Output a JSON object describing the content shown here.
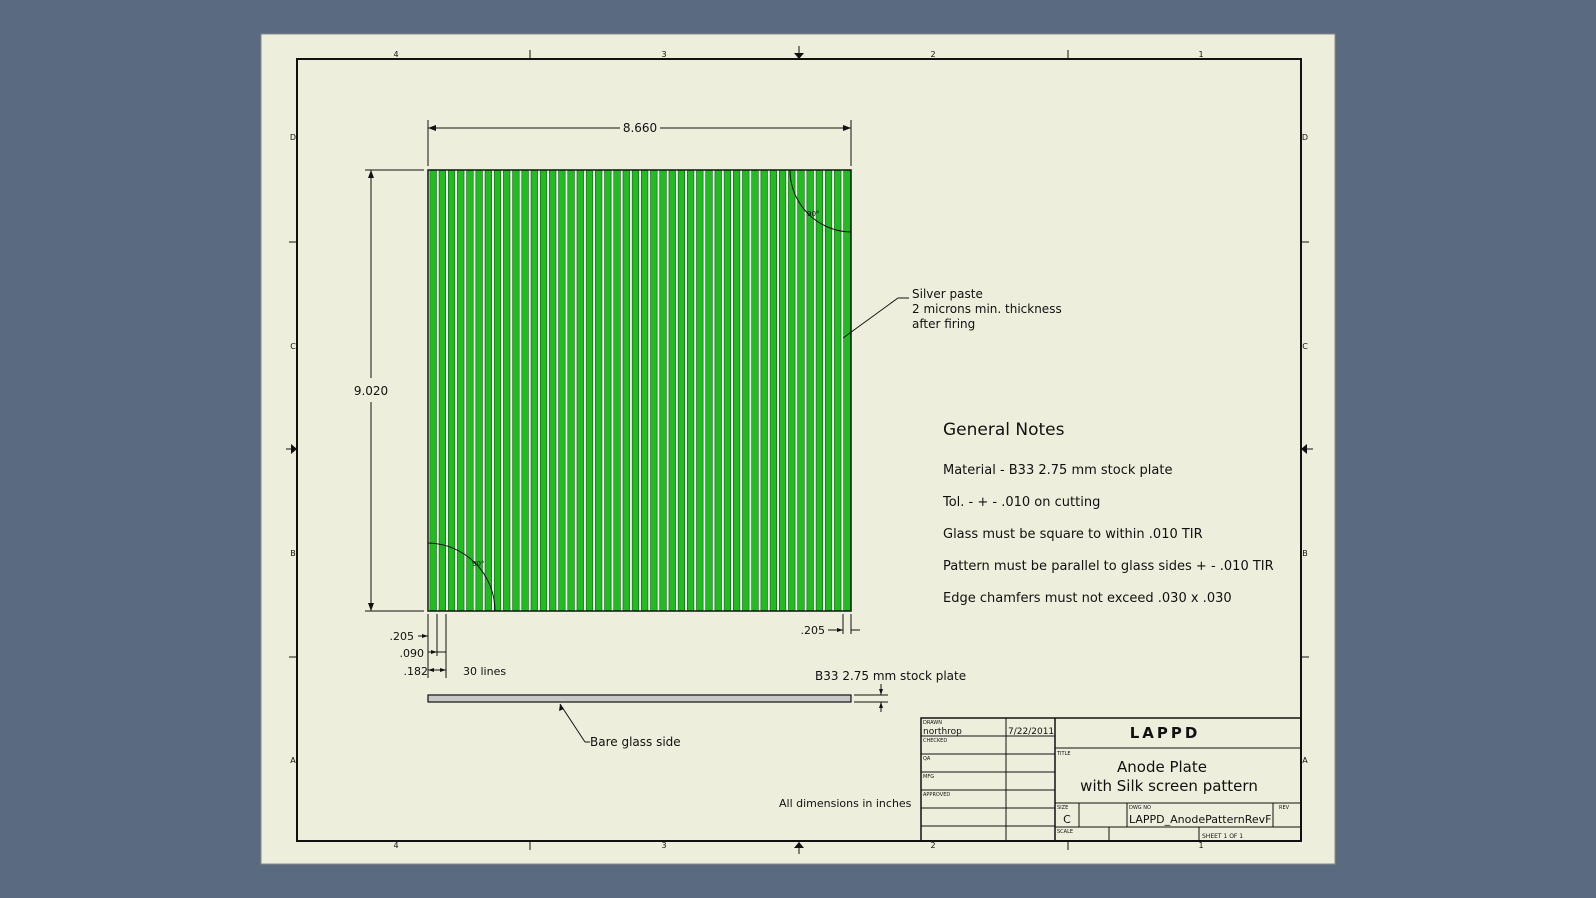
{
  "zone_labels": {
    "top": [
      "4",
      "3",
      "2",
      "1"
    ],
    "bottom": [
      "4",
      "3",
      "2",
      "1"
    ],
    "left": [
      "D",
      "C",
      "B",
      "A"
    ],
    "right": [
      "D",
      "C",
      "B",
      "A"
    ]
  },
  "dimensions": {
    "width": "8.660",
    "height": "9.020",
    "left_margin": ".205",
    "right_margin": ".205",
    "line_width": ".090",
    "pitch": ".182",
    "line_count": "30 lines",
    "chamfer_tr": "90°",
    "chamfer_bl": "90°"
  },
  "callouts": {
    "silver_paste": [
      "Silver paste",
      "2 microns min. thickness",
      "after firing"
    ],
    "stock_plate": "B33 2.75 mm stock plate",
    "bare_glass": "Bare glass side"
  },
  "general_notes": {
    "heading": "General Notes",
    "items": [
      "Material - B33 2.75 mm stock plate",
      "Tol. -  + - .010 on cutting",
      "Glass must be square to within .010 TIR",
      "Pattern must be parallel to glass sides  + - .010 TIR",
      "Edge chamfers must not exceed .030 x .030"
    ]
  },
  "all_dimensions": "All dimensions in inches",
  "title_block": {
    "drawn_label": "DRAWN",
    "drawn_by": "northrop",
    "date": "7/22/2011",
    "checked_label": "CHECKED",
    "qa_label": "QA",
    "mfg_label": "MFG",
    "approved_label": "APPROVED",
    "company": "LAPPD",
    "title_label": "TITLE",
    "title_line1": "Anode Plate",
    "title_line2": "with Silk screen pattern",
    "size_label": "SIZE",
    "size": "C",
    "dwg_label": "DWG NO",
    "dwg_no": "LAPPD_AnodePatternRevF",
    "rev_label": "REV",
    "scale_label": "SCALE",
    "sheet": "SHEET 1  OF 1"
  },
  "colors": {
    "background": "#5b6b7f",
    "sheet": "#eeeedd",
    "pattern": "#22bb22",
    "stroke": "#111111"
  }
}
